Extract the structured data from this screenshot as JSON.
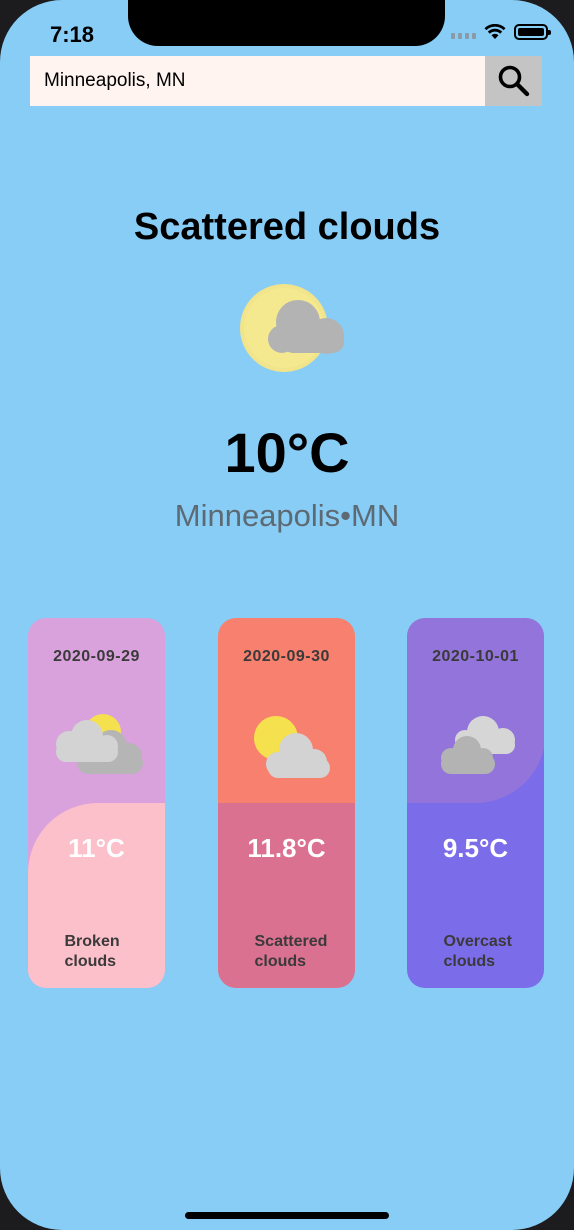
{
  "status_bar": {
    "time": "7:18"
  },
  "search": {
    "value": "Minneapolis, MN",
    "button_icon": "search-icon"
  },
  "current": {
    "condition": "Scattered clouds",
    "temperature": "10°C",
    "location": "Minneapolis•MN",
    "icon": "sun-behind-cloud-icon"
  },
  "forecast": [
    {
      "date": "2020-09-29",
      "temperature": "11°C",
      "description": "Broken clouds",
      "top_color": "#d9a2dd",
      "bottom_color": "#fcc0cb",
      "icon": "broken-clouds-icon"
    },
    {
      "date": "2020-09-30",
      "temperature": "11.8°C",
      "description": "Scattered clouds",
      "top_color": "#f8806f",
      "bottom_color": "#db7190",
      "icon": "scattered-clouds-icon"
    },
    {
      "date": "2020-10-01",
      "temperature": "9.5°C",
      "description": "Overcast clouds",
      "top_color": "#9274da",
      "bottom_color": "#7b6cea",
      "icon": "overcast-clouds-icon"
    }
  ],
  "colors": {
    "background": "#87cdf6",
    "search_field": "#fff4f0",
    "search_button": "#c4c4c4"
  }
}
